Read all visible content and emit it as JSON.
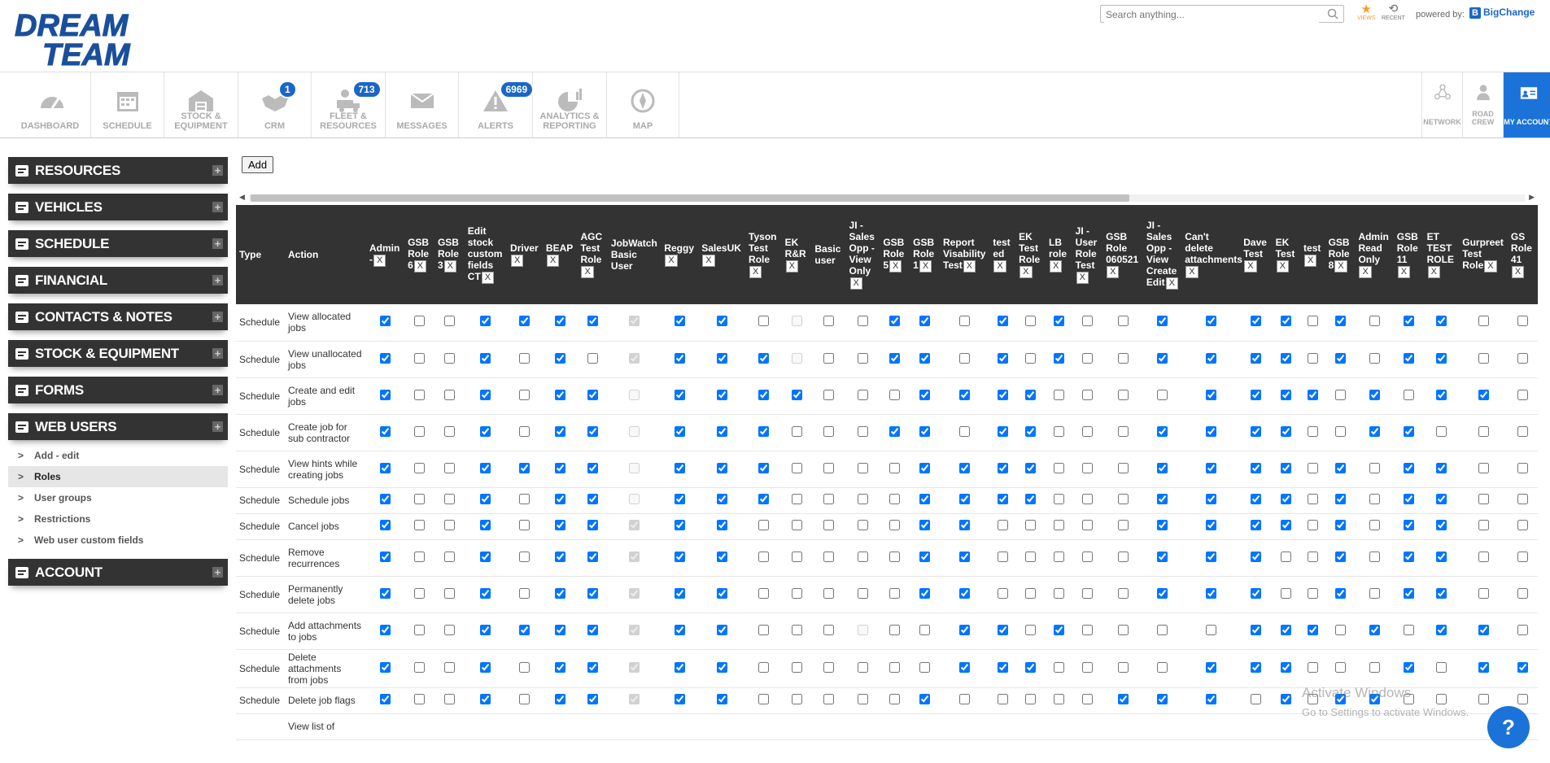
{
  "header": {
    "search_placeholder": "Search anything...",
    "views_label": "VIEWS",
    "recent_label": "RECENT",
    "powered_label": "powered by:",
    "powered_brand": "BigChange"
  },
  "nav": {
    "items": [
      {
        "label": "DASHBOARD",
        "icon": "gauge-icon",
        "badge": ""
      },
      {
        "label": "SCHEDULE",
        "icon": "calendar-icon",
        "badge": ""
      },
      {
        "label": "STOCK & EQUIPMENT",
        "icon": "warehouse-icon",
        "badge": ""
      },
      {
        "label": "CRM",
        "icon": "handshake-icon",
        "badge": "1"
      },
      {
        "label": "FLEET & RESOURCES",
        "icon": "fleet-icon",
        "badge": "713"
      },
      {
        "label": "MESSAGES",
        "icon": "envelope-icon",
        "badge": ""
      },
      {
        "label": "ALERTS",
        "icon": "alert-icon",
        "badge": "6969"
      },
      {
        "label": "ANALYTICS & REPORTING",
        "icon": "pie-chart-icon",
        "badge": ""
      },
      {
        "label": "MAP",
        "icon": "compass-icon",
        "badge": ""
      }
    ],
    "right": [
      {
        "label": "NETWORK",
        "icon": "network-icon"
      },
      {
        "label": "ROAD CREW",
        "icon": "road-crew-icon"
      },
      {
        "label": "MY ACCOUNT",
        "icon": "id-card-icon"
      }
    ]
  },
  "sidebar": {
    "sections": [
      {
        "label": "RESOURCES",
        "icon": "users-icon"
      },
      {
        "label": "VEHICLES",
        "icon": "vehicle-gear-icon"
      },
      {
        "label": "SCHEDULE",
        "icon": "calendar-icon"
      },
      {
        "label": "FINANCIAL",
        "icon": "money-icon"
      },
      {
        "label": "CONTACTS & NOTES",
        "icon": "flag-icon"
      },
      {
        "label": "STOCK & EQUIPMENT",
        "icon": "warehouse-icon"
      },
      {
        "label": "FORMS",
        "icon": "form-icon"
      },
      {
        "label": "WEB USERS",
        "icon": "web-user-icon"
      }
    ],
    "web_users_sub": [
      "Add - edit",
      "Roles",
      "User groups",
      "Restrictions",
      "Web user custom fields"
    ],
    "account": {
      "label": "ACCOUNT",
      "icon": "id-card-icon"
    }
  },
  "content": {
    "add_label": "Add",
    "col_type": "Type",
    "col_action": "Action",
    "roles": [
      "Admin -",
      "GSB Role 6",
      "GSB Role 3",
      "Edit stock custom fields CT",
      "Driver",
      "BEAP",
      "AGC Test Role",
      "JobWatch Basic User",
      "Reggy",
      "SalesUK",
      "Tyson Test Role",
      "EK R&R",
      "Basic user",
      "JI - Sales Opp - View Only",
      "GSB Role 5",
      "GSB Role 1",
      "Report Visability Test",
      "test ed",
      "EK Test Role",
      "LB role",
      "JI - User Role Test",
      "GSB Role 060521",
      "JI - Sales Opp - View Create Edit",
      "Can't delete attachments",
      "Dave Test",
      "EK Test",
      "test",
      "GSB Role 8",
      "Admin Read Only",
      "GSB Role 11",
      "ET TEST ROLE",
      "Gurpreet Test Role",
      "GS Role 41"
    ],
    "role_x": [
      "X",
      "X",
      "X",
      "X",
      "X",
      "X",
      "X",
      "",
      "X",
      "X",
      "X",
      "X",
      "",
      "X",
      "X",
      "X",
      "X",
      "X",
      "X",
      "X",
      "X",
      "X",
      "X",
      "X",
      "X",
      "X",
      "X",
      "X",
      "X",
      "X",
      "X",
      "X",
      "X"
    ],
    "rows": [
      {
        "type": "Schedule",
        "action": "View allocated jobs",
        "v": "1001111D110d001101010011110101100"
      },
      {
        "type": "Schedule",
        "action": "View unallocated jobs",
        "v": "1001010D111d001101010011110101100"
      },
      {
        "type": "Schedule",
        "action": "Create and edit jobs",
        "v": "1001011d11110001111000011110101100"
      },
      {
        "type": "Schedule",
        "action": "Create job for sub contractor",
        "v": "1001011d111000110110001111001100"
      },
      {
        "type": "Schedule",
        "action": "View hints while creating jobs",
        "v": "1001111d111000011110001111010110"
      },
      {
        "type": "Schedule",
        "action": "Schedule jobs",
        "v": "1001011d111000011110001111010110"
      },
      {
        "type": "Schedule",
        "action": "Cancel jobs",
        "v": "1001011D110000011000001111010110"
      },
      {
        "type": "Schedule",
        "action": "Remove recurrences",
        "v": "1001011D110000011000001110010110"
      },
      {
        "type": "Schedule",
        "action": "Permanently delete jobs",
        "v": "1001011D110000011000001110010110"
      },
      {
        "type": "Schedule",
        "action": "Add attachments to jobs",
        "v": "1001111D11000d0011010000111010110"
      },
      {
        "type": "Schedule",
        "action": "Delete attachments from jobs",
        "v": "1001011D11000000111000011100010110"
      },
      {
        "type": "Schedule",
        "action": "Delete job flags",
        "v": "1001011D1100000100000111010110"
      },
      {
        "type": "",
        "action": "View list of",
        "v": ""
      }
    ]
  },
  "overlay": {
    "watermark_title": "Activate Windows",
    "watermark_sub": "Go to Settings to activate Windows.",
    "help_label": "?"
  }
}
